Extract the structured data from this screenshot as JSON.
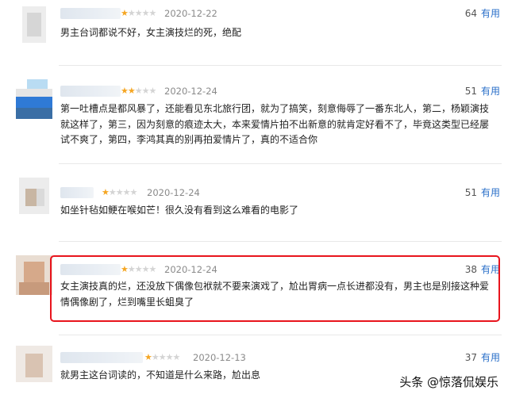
{
  "reviews": [
    {
      "date": "2020-12-22",
      "rating": 1,
      "useful_count": "64",
      "useful_label": "有用",
      "text": "男主台词都说不好，女主演技烂的死，绝配"
    },
    {
      "date": "2020-12-24",
      "rating": 2,
      "useful_count": "51",
      "useful_label": "有用",
      "text": "第一吐槽点是都风暴了，还能看见东北旅行团，就为了搞笑，刻意侮辱了一番东北人，第二，杨颖演技就这样了，第三，因为刻意的痕迹太大，本来爱情片拍不出新意的就肯定好看不了，毕竟这类型已经屡试不爽了，第四，李鸿其真的别再拍爱情片了，真的不适合你"
    },
    {
      "date": "2020-12-24",
      "rating": 1,
      "useful_count": "51",
      "useful_label": "有用",
      "text": "如坐针毡如鲠在喉如芒！很久没有看到这么难看的电影了"
    },
    {
      "date": "2020-12-24",
      "rating": 1,
      "useful_count": "38",
      "useful_label": "有用",
      "text": "女主演技真的烂，还没放下偶像包袱就不要来演戏了，尬出胃病一点长进都没有，男主也是别接这种爱情偶像剧了，烂到嘴里长蛆臭了"
    },
    {
      "date": "2020-12-13",
      "rating": 1,
      "useful_count": "37",
      "useful_label": "有用",
      "text": "就男主这台词读的，不知道是什么来路，尬出息"
    }
  ],
  "watermark": {
    "text": "头条 @惊落侃娱乐"
  },
  "colors": {
    "highlight": "#e8141d",
    "star": "#f5a623",
    "link": "#2a6fc9"
  }
}
